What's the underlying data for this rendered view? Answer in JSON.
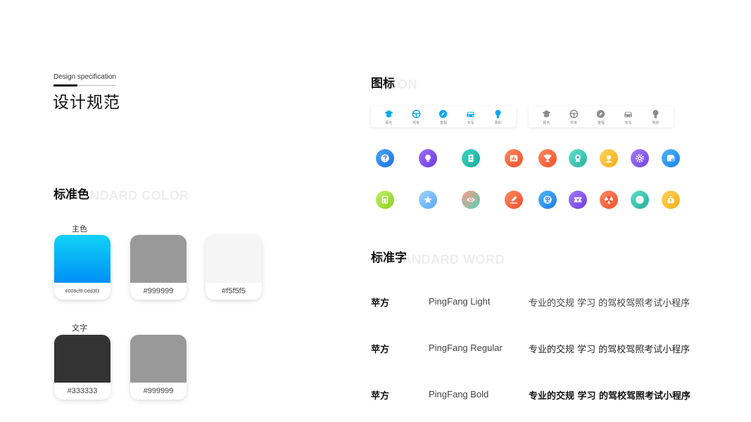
{
  "header": {
    "subtitle": "Design specification",
    "title": "设计规范"
  },
  "standard_color": {
    "title": "标准色",
    "ghost": "STANDARD COLOR",
    "main_group": {
      "label": "主色",
      "swatches": [
        {
          "code": "#008cf8-0dd3f3",
          "colors": [
            "#10d3f5",
            "#0090f7"
          ]
        },
        {
          "code": "#999999",
          "colors": [
            "#999999"
          ]
        },
        {
          "code": "#f5f5f5",
          "colors": [
            "#f5f5f5"
          ]
        }
      ]
    },
    "text_group": {
      "label": "文字",
      "swatches": [
        {
          "code": "#333333",
          "colors": [
            "#333333"
          ]
        },
        {
          "code": "#999999",
          "colors": [
            "#999999"
          ]
        }
      ]
    }
  },
  "icon_section": {
    "title": "图标",
    "ghost": "ICON",
    "nav_active": [
      {
        "label": "报名",
        "icon": "graduation-cap-icon",
        "color": "#0aa6f2"
      },
      {
        "label": "驾考",
        "icon": "steering-wheel-icon",
        "color": "#0aa6f2"
      },
      {
        "label": "童程",
        "icon": "compass-icon",
        "color": "#0aa6f2"
      },
      {
        "label": "买车",
        "icon": "car-icon",
        "color": "#0aa6f2"
      },
      {
        "label": "我的",
        "icon": "user-icon",
        "color": "#0aa6f2"
      }
    ],
    "nav_inactive": [
      {
        "label": "报名",
        "icon": "graduation-cap-icon",
        "color": "#8c8c8c"
      },
      {
        "label": "驾考",
        "icon": "steering-wheel-icon",
        "color": "#8c8c8c"
      },
      {
        "label": "童程",
        "icon": "compass-icon",
        "color": "#8c8c8c"
      },
      {
        "label": "买车",
        "icon": "car-icon",
        "color": "#8c8c8c"
      },
      {
        "label": "我的",
        "icon": "user-icon",
        "color": "#8c8c8c"
      }
    ],
    "row1": [
      {
        "icon": "question-icon",
        "colors": [
          "#4aa8f5",
          "#1d6fe0"
        ]
      },
      {
        "icon": "lightbulb-icon",
        "colors": [
          "#a06cf5",
          "#6a3ce0"
        ]
      },
      {
        "icon": "id-card-icon",
        "colors": [
          "#40d6c4",
          "#16a99b"
        ]
      },
      {
        "icon": "bar-chart-icon",
        "colors": [
          "#ff8a5c",
          "#f0502e"
        ]
      },
      {
        "icon": "trophy-icon",
        "colors": [
          "#ff8a5c",
          "#f2502c"
        ]
      },
      {
        "icon": "medal-icon",
        "colors": [
          "#5fe0c9",
          "#27b39f"
        ]
      },
      {
        "icon": "coach-icon",
        "colors": [
          "#ffd65a",
          "#f5ab16"
        ]
      },
      {
        "icon": "gear-icon",
        "colors": [
          "#a778f7",
          "#7048e3"
        ]
      },
      {
        "icon": "wallet-icon",
        "colors": [
          "#4cb6fb",
          "#1e80ea"
        ]
      }
    ],
    "row2": [
      {
        "icon": "calculator-icon",
        "colors": [
          "#c6f06a",
          "#84d21d"
        ]
      },
      {
        "icon": "star-icon",
        "colors": [
          "#9fd3ff",
          "#5aa6f2"
        ]
      },
      {
        "icon": "eye-icon",
        "colors": [
          "#ff9a8a",
          "#56d0b0"
        ]
      },
      {
        "icon": "edit-icon",
        "colors": [
          "#ff8a5c",
          "#f0502e"
        ]
      },
      {
        "icon": "free-badge-icon",
        "colors": [
          "#4cb6fb",
          "#1b7ce8"
        ]
      },
      {
        "icon": "ticket-icon",
        "colors": [
          "#a778f7",
          "#6c40e0"
        ]
      },
      {
        "icon": "radiation-icon",
        "colors": [
          "#ff8a5c",
          "#f0502e"
        ]
      },
      {
        "icon": "compass-icon",
        "colors": [
          "#5fe0c9",
          "#22ad99"
        ]
      },
      {
        "icon": "money-bag-icon",
        "colors": [
          "#ffd65a",
          "#f5ab16"
        ]
      }
    ]
  },
  "standard_word": {
    "title": "标准字",
    "ghost": "STANDARD WORD",
    "rows": [
      {
        "name": "苹方",
        "family": "PingFang Light",
        "sample": "专业的交规 学习 的驾校驾照考试小程序",
        "weight": "light"
      },
      {
        "name": "苹方",
        "family": "PingFang Regular",
        "sample": "专业的交规 学习 的驾校驾照考试小程序",
        "weight": "regular"
      },
      {
        "name": "苹方",
        "family": "PingFang Bold",
        "sample": "专业的交规 学习 的驾校驾照考试小程序",
        "weight": "bold"
      }
    ]
  }
}
